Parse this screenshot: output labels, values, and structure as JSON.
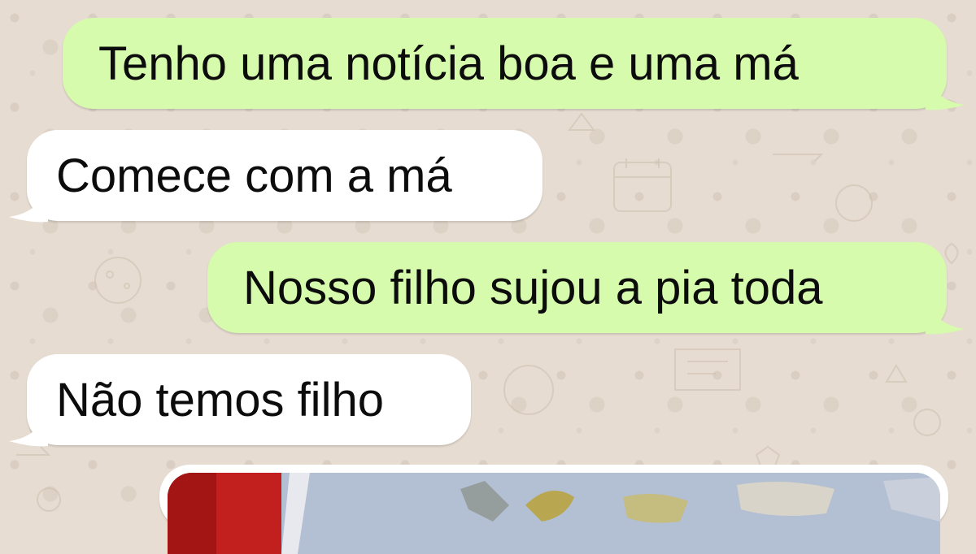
{
  "chat": {
    "messages": [
      {
        "direction": "outgoing",
        "text": "Tenho uma notícia boa e uma má"
      },
      {
        "direction": "incoming",
        "text": "Comece com a má"
      },
      {
        "direction": "outgoing",
        "text": "Nosso filho sujou a pia toda"
      },
      {
        "direction": "incoming",
        "text": "Não temos filho"
      },
      {
        "direction": "outgoing",
        "type": "image",
        "content": "photo-partially-visible"
      }
    ]
  },
  "colors": {
    "outgoing_bubble": "#d6fbac",
    "incoming_bubble": "#ffffff",
    "wallpaper": "#e6dcd1",
    "text": "#0c0c0c"
  }
}
